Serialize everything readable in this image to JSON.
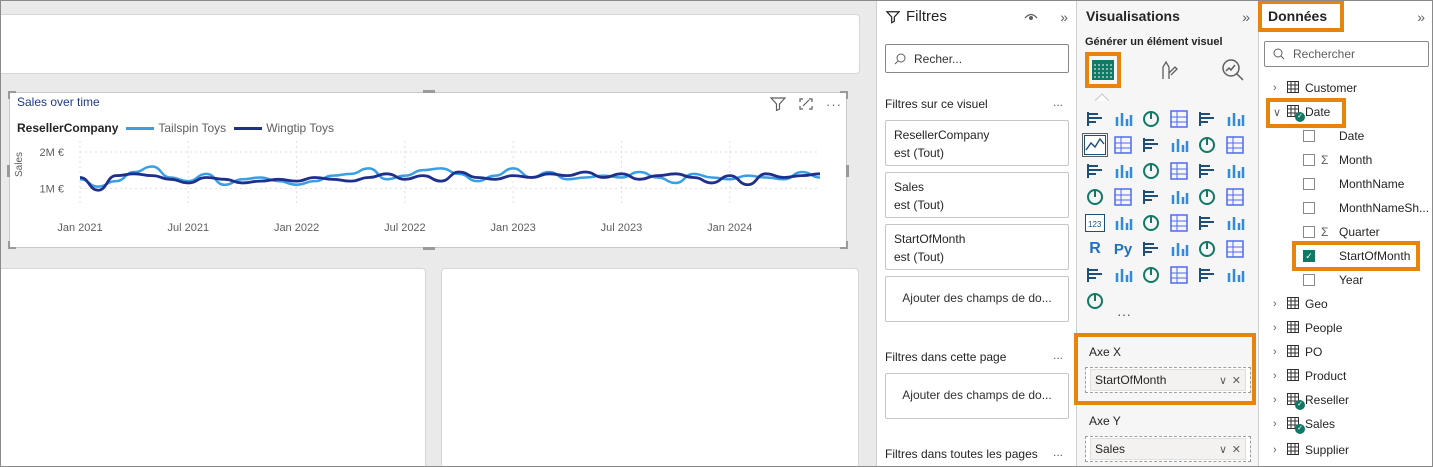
{
  "visual": {
    "title": "Sales over time",
    "legend_title": "ResellerCompany",
    "y_axis_label": "Sales",
    "y_ticks": [
      "2M €",
      "1M €"
    ],
    "x_ticks": [
      "Jan 2021",
      "Jul 2021",
      "Jan 2022",
      "Jul 2022",
      "Jan 2023",
      "Jul 2023",
      "Jan 2024"
    ],
    "icons": [
      "filter-icon",
      "focus-mode-icon",
      "more-options-icon"
    ]
  },
  "chart_data": {
    "type": "line",
    "title": "Sales over time",
    "xlabel": "",
    "ylabel": "Sales",
    "ylim": [
      0.6,
      2.3
    ],
    "yunit": "M €",
    "legend_title": "ResellerCompany",
    "legend_position": "top-left",
    "grid": true,
    "x": [
      "Jan 2021",
      "Feb 2021",
      "Mar 2021",
      "Apr 2021",
      "May 2021",
      "Jun 2021",
      "Jul 2021",
      "Aug 2021",
      "Sep 2021",
      "Oct 2021",
      "Nov 2021",
      "Dec 2021",
      "Jan 2022",
      "Feb 2022",
      "Mar 2022",
      "Apr 2022",
      "May 2022",
      "Jun 2022",
      "Jul 2022",
      "Aug 2022",
      "Sep 2022",
      "Oct 2022",
      "Nov 2022",
      "Dec 2022",
      "Jan 2023",
      "Feb 2023",
      "Mar 2023",
      "Apr 2023",
      "May 2023",
      "Jun 2023",
      "Jul 2023",
      "Aug 2023",
      "Sep 2023",
      "Oct 2023",
      "Nov 2023",
      "Dec 2023",
      "Jan 2024",
      "Feb 2024",
      "Mar 2024",
      "Apr 2024",
      "May 2024",
      "Jun 2024"
    ],
    "series": [
      {
        "name": "Tailspin Toys",
        "color": "#3a9ee4",
        "values": [
          1.25,
          1.05,
          1.2,
          1.45,
          1.6,
          1.3,
          1.2,
          1.4,
          1.1,
          1.25,
          1.3,
          1.2,
          1.1,
          1.2,
          1.35,
          1.4,
          1.55,
          1.25,
          1.35,
          1.5,
          1.55,
          1.4,
          1.2,
          1.35,
          1.55,
          1.3,
          1.45,
          1.25,
          1.3,
          1.35,
          1.3,
          1.45,
          1.3,
          1.15,
          1.4,
          1.3,
          1.25,
          1.35,
          1.3,
          1.25,
          1.45,
          1.3
        ]
      },
      {
        "name": "Wingtip Toys",
        "color": "#1f2f8c",
        "values": [
          1.3,
          0.95,
          1.35,
          1.4,
          1.35,
          1.25,
          1.15,
          1.3,
          1.25,
          1.15,
          1.2,
          1.25,
          1.2,
          1.3,
          1.25,
          1.2,
          1.3,
          1.4,
          1.25,
          1.35,
          1.2,
          1.45,
          1.3,
          1.25,
          1.35,
          1.3,
          1.4,
          1.35,
          1.45,
          1.3,
          1.4,
          1.25,
          1.35,
          1.4,
          1.3,
          1.15,
          1.35,
          1.1,
          1.4,
          1.3,
          1.35,
          1.4
        ]
      }
    ]
  },
  "filters": {
    "title": "Filtres",
    "search_placeholder": "Recher...",
    "section_visual": "Filtres sur ce visuel",
    "visual_filters": [
      {
        "field": "ResellerCompany",
        "value": "est (Tout)"
      },
      {
        "field": "Sales",
        "value": "est (Tout)"
      },
      {
        "field": "StartOfMonth",
        "value": "est (Tout)"
      }
    ],
    "add_fields": "Ajouter des champs de do...",
    "section_page": "Filtres dans cette page",
    "section_all": "Filtres dans toutes les pages",
    "more": "..."
  },
  "viz": {
    "title": "Visualisations",
    "build_label": "Générer un élément visuel",
    "tabs": [
      "build-visual-icon",
      "format-visual-icon",
      "analytics-icon"
    ],
    "more": "···",
    "x_axis_label": "Axe X",
    "x_axis_field": "StartOfMonth",
    "y_axis_label": "Axe Y",
    "y_axis_field": "Sales",
    "r_label": "R",
    "py_label": "Py",
    "num_label": "123",
    "accent": "#e8830c"
  },
  "data": {
    "title": "Données",
    "search_placeholder": "Rechercher",
    "tables": [
      "Customer",
      "Date",
      "Geo",
      "People",
      "PO",
      "Product",
      "Reseller",
      "Sales",
      "Supplier"
    ],
    "date_fields": [
      "Date",
      "Month",
      "MonthName",
      "MonthNameSh...",
      "Quarter",
      "StartOfMonth",
      "Year"
    ]
  }
}
